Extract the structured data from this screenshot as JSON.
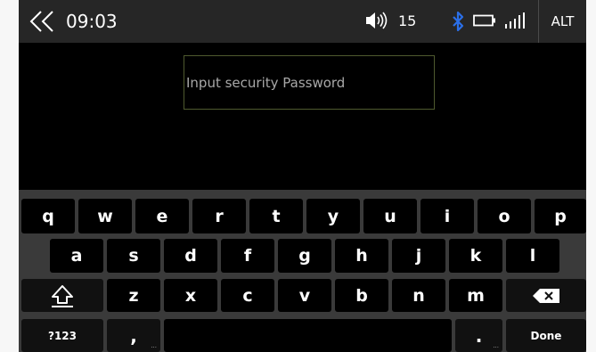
{
  "status_bar": {
    "back_icon": "double-chevron-left-icon",
    "time": "09:03",
    "volume_icon": "speaker-icon",
    "volume_level": "15",
    "bluetooth_icon": "bluetooth-icon",
    "bluetooth_color": "#2b6fe8",
    "battery_icon": "battery-icon",
    "signal_icon": "signal-bars-icon",
    "alt_label": "ALT"
  },
  "password_field": {
    "placeholder": "Input security Password",
    "border_color": "#4f5a2f"
  },
  "keyboard": {
    "row1": [
      "q",
      "w",
      "e",
      "r",
      "t",
      "y",
      "u",
      "i",
      "o",
      "p"
    ],
    "row2": [
      "a",
      "s",
      "d",
      "f",
      "g",
      "h",
      "j",
      "k",
      "l"
    ],
    "row3": [
      "z",
      "x",
      "c",
      "v",
      "b",
      "n",
      "m"
    ],
    "shift_icon": "shift-arrow-icon",
    "backspace_icon": "backspace-icon",
    "symbols_label": "?123",
    "comma_label": ",",
    "comma_hint": "...",
    "period_label": ".",
    "period_hint": "...",
    "done_label": "Done"
  }
}
